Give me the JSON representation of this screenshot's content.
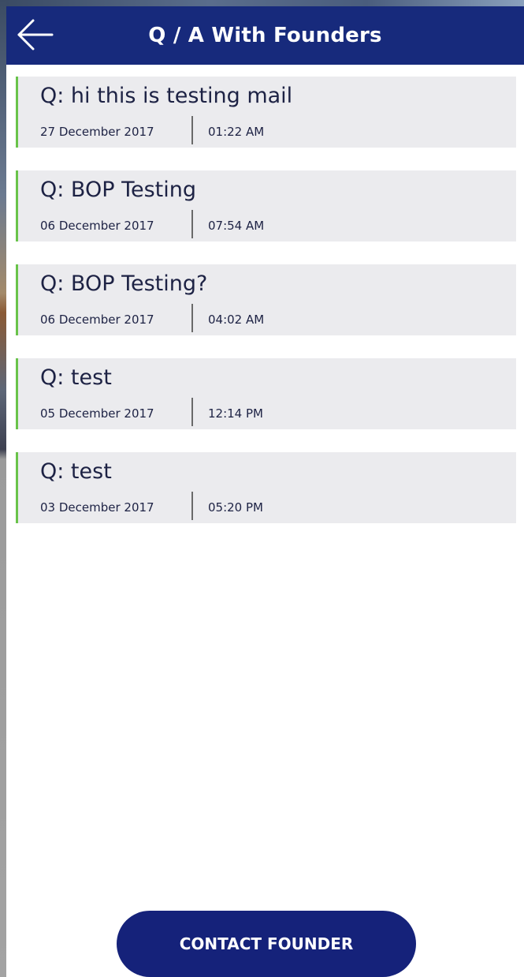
{
  "header": {
    "title": "Q / A With Founders",
    "back_icon": "arrow-left-icon",
    "color": "#172a7c"
  },
  "questions": [
    {
      "question": "Q: hi this is testing mail",
      "date": "27 December 2017",
      "time": "01:22 AM"
    },
    {
      "question": "Q: BOP Testing",
      "date": "06 December 2017",
      "time": "07:54 AM"
    },
    {
      "question": "Q: BOP Testing?",
      "date": "06 December 2017",
      "time": "04:02 AM"
    },
    {
      "question": "Q: test",
      "date": "05 December 2017",
      "time": "12:14 PM"
    },
    {
      "question": "Q: test",
      "date": "03 December 2017",
      "time": "05:20 PM"
    }
  ],
  "accent_color": "#69c34a",
  "contact_button": {
    "label": "CONTACT FOUNDER",
    "color": "#15227a"
  }
}
